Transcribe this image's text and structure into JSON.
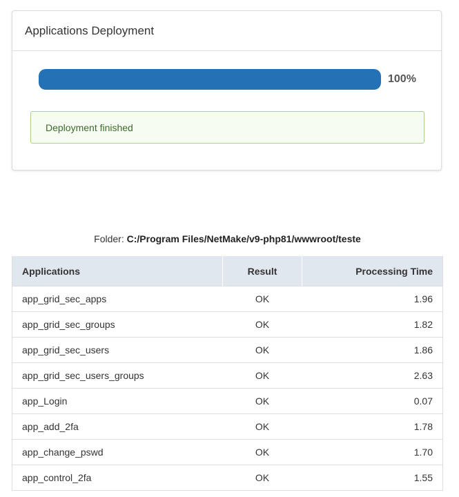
{
  "panel": {
    "title": "Applications Deployment",
    "progress": {
      "percent": 100,
      "label": "100%",
      "bar_color": "#2472b5"
    },
    "alert": {
      "message": "Deployment finished",
      "border_color": "#a9d18e"
    }
  },
  "folder": {
    "label": "Folder:",
    "path": "C:/Program Files/NetMake/v9-php81/wwwroot/teste"
  },
  "table": {
    "headers": {
      "applications": "Applications",
      "result": "Result",
      "processing_time": "Processing Time"
    },
    "rows": [
      {
        "app": "app_grid_sec_apps",
        "result": "OK",
        "time": "1.96"
      },
      {
        "app": "app_grid_sec_groups",
        "result": "OK",
        "time": "1.82"
      },
      {
        "app": "app_grid_sec_users",
        "result": "OK",
        "time": "1.86"
      },
      {
        "app": "app_grid_sec_users_groups",
        "result": "OK",
        "time": "2.63"
      },
      {
        "app": "app_Login",
        "result": "OK",
        "time": "0.07"
      },
      {
        "app": "app_add_2fa",
        "result": "OK",
        "time": "1.78"
      },
      {
        "app": "app_change_pswd",
        "result": "OK",
        "time": "1.70"
      },
      {
        "app": "app_control_2fa",
        "result": "OK",
        "time": "1.55"
      }
    ]
  }
}
